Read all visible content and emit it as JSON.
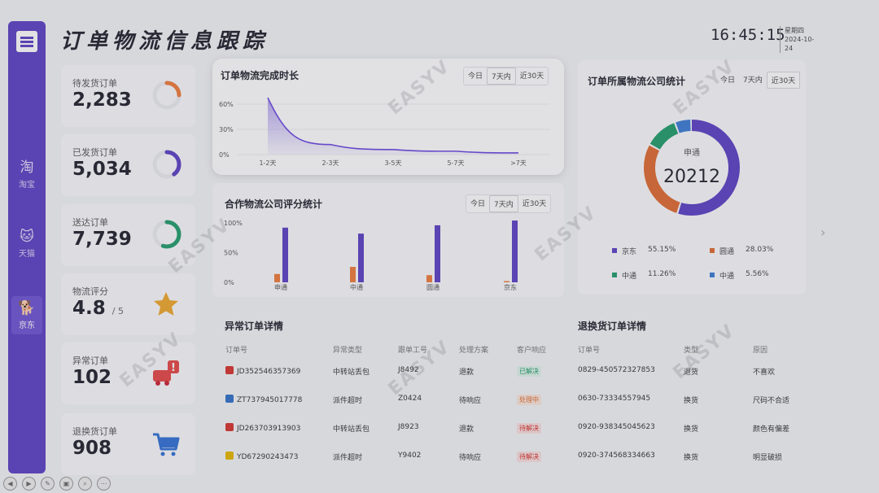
{
  "header": {
    "title": "订单物流信息跟踪",
    "time": "16:45:15",
    "weekday": "星期四",
    "date": "2024-10-24"
  },
  "sidebar": {
    "items": [
      {
        "label": "淘宝",
        "glyph": "淘"
      },
      {
        "label": "天猫",
        "glyph": "猫"
      },
      {
        "label": "京东",
        "glyph": "狗"
      }
    ],
    "active": "京东"
  },
  "stats": [
    {
      "label": "待发货订单",
      "value": "2,283",
      "ratio": 0.25,
      "color": "#f07a3a"
    },
    {
      "label": "已发货订单",
      "value": "5,034",
      "ratio": 0.4,
      "color": "#5b3fc4"
    },
    {
      "label": "送达订单",
      "value": "7,739",
      "ratio": 0.55,
      "color": "#1f9d6b"
    },
    {
      "label": "物流评分",
      "value": "4.8",
      "sub": "/ 5",
      "icon": "star-icon"
    },
    {
      "label": "异常订单",
      "value": "102",
      "icon": "truck-alert-icon"
    },
    {
      "label": "退换货订单",
      "value": "908",
      "icon": "cart-icon"
    }
  ],
  "filters": [
    "今日",
    "7天内",
    "近30天"
  ],
  "panel_duration": {
    "title": "订单物流完成时长",
    "selected": "7天内"
  },
  "panel_rating": {
    "title": "合作物流公司评分统计",
    "selected": "7天内"
  },
  "panel_share": {
    "title": "订单所属物流公司统计",
    "selected": "近30天",
    "center_label": "申通",
    "center_value": "20212"
  },
  "chart_data": [
    {
      "type": "area",
      "categories": [
        "1-2天",
        "2-3天",
        "3-5天",
        "5-7天",
        ">7天"
      ],
      "values": [
        68,
        12,
        6,
        4,
        2
      ],
      "yticks": [
        "60%",
        "30%",
        "0%"
      ],
      "ylim": [
        0,
        70
      ]
    },
    {
      "type": "bar",
      "categories": [
        "申通",
        "中通",
        "圆通",
        "京东"
      ],
      "yticks": [
        "100%",
        "50%",
        "0%"
      ],
      "ylim": [
        0,
        100
      ],
      "series": [
        {
          "values": [
            14,
            26,
            12,
            2
          ],
          "color": "#f07a3a"
        },
        {
          "values": [
            92,
            82,
            96,
            104
          ],
          "color": "#5b3fc4"
        }
      ]
    },
    {
      "type": "pie",
      "categories": [
        "京东",
        "圆通",
        "中通",
        "中通"
      ],
      "values": [
        55.15,
        28.03,
        11.26,
        5.56
      ],
      "labels": [
        "55.15%",
        "28.03%",
        "11.26%",
        "5.56%"
      ],
      "colors": [
        "#5b3fc4",
        "#e0692f",
        "#1f9d6b",
        "#3a7bd5"
      ]
    }
  ],
  "abnormal": {
    "title": "异常订单详情",
    "headers": [
      "订单号",
      "异常类型",
      "跟单工号",
      "处理方案",
      "客户响应"
    ],
    "rows": [
      {
        "order": "JD352546357369",
        "type": "中转站丢包",
        "staff": "J8492",
        "plan": "退款",
        "status": "已解决",
        "status_color": "#1f9d6b",
        "status_bg": "#dff3ea",
        "logo_color": "#d6312b"
      },
      {
        "order": "ZT737945017778",
        "type": "派件超时",
        "staff": "Z0424",
        "plan": "待响应",
        "status": "处理中",
        "status_color": "#e0692f",
        "status_bg": "#fbe6da",
        "logo_color": "#2f6fc9"
      },
      {
        "order": "JD263703913903",
        "type": "中转站丢包",
        "staff": "J8923",
        "plan": "退款",
        "status": "待解决",
        "status_color": "#d6312b",
        "status_bg": "#f9dede",
        "logo_color": "#d6312b"
      },
      {
        "order": "YD67290243473",
        "type": "派件超时",
        "staff": "Y9402",
        "plan": "待响应",
        "status": "待解决",
        "status_color": "#d6312b",
        "status_bg": "#f9dede",
        "logo_color": "#e6b800"
      }
    ]
  },
  "returns": {
    "title": "退换货订单详情",
    "headers": [
      "订单号",
      "类型",
      "原因"
    ],
    "rows": [
      {
        "order": "0829-450572327853",
        "type": "退货",
        "reason": "不喜欢"
      },
      {
        "order": "0630-73334557945",
        "type": "换货",
        "reason": "尺码不合适"
      },
      {
        "order": "0920-938345045623",
        "type": "换货",
        "reason": "颜色有偏差"
      },
      {
        "order": "0920-374568334663",
        "type": "换货",
        "reason": "明显破损"
      }
    ]
  },
  "watermark": "EASYV"
}
